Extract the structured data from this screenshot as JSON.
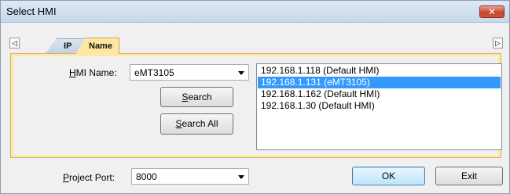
{
  "window": {
    "title": "Select HMI",
    "close_glyph": "✕"
  },
  "tabs": [
    {
      "label": "IP",
      "active": false
    },
    {
      "label": "Name",
      "active": true
    }
  ],
  "tab_scroll": {
    "left_glyph": "◁",
    "right_glyph": "▷"
  },
  "hmi_name": {
    "label_prefix": "",
    "label_accel": "H",
    "label_rest": "MI Name:",
    "value": "eMT3105"
  },
  "buttons": {
    "search": {
      "accel": "S",
      "rest": "earch"
    },
    "search_all": {
      "accel": "S",
      "rest": "earch All"
    },
    "ok": "OK",
    "exit": "Exit"
  },
  "hmi_list": {
    "items": [
      "192.168.1.118 (Default HMI)",
      "192.168.1.131 (eMT3105)",
      "192.168.1.162 (Default HMI)",
      "192.168.1.30 (Default HMI)"
    ],
    "selected_index": 1
  },
  "project_port": {
    "label_accel": "P",
    "label_rest": "roject Port:",
    "value": "8000"
  },
  "colors": {
    "selection": "#3399ff",
    "tab_active": "#ffe7a3",
    "close_button": "#c7452f"
  }
}
